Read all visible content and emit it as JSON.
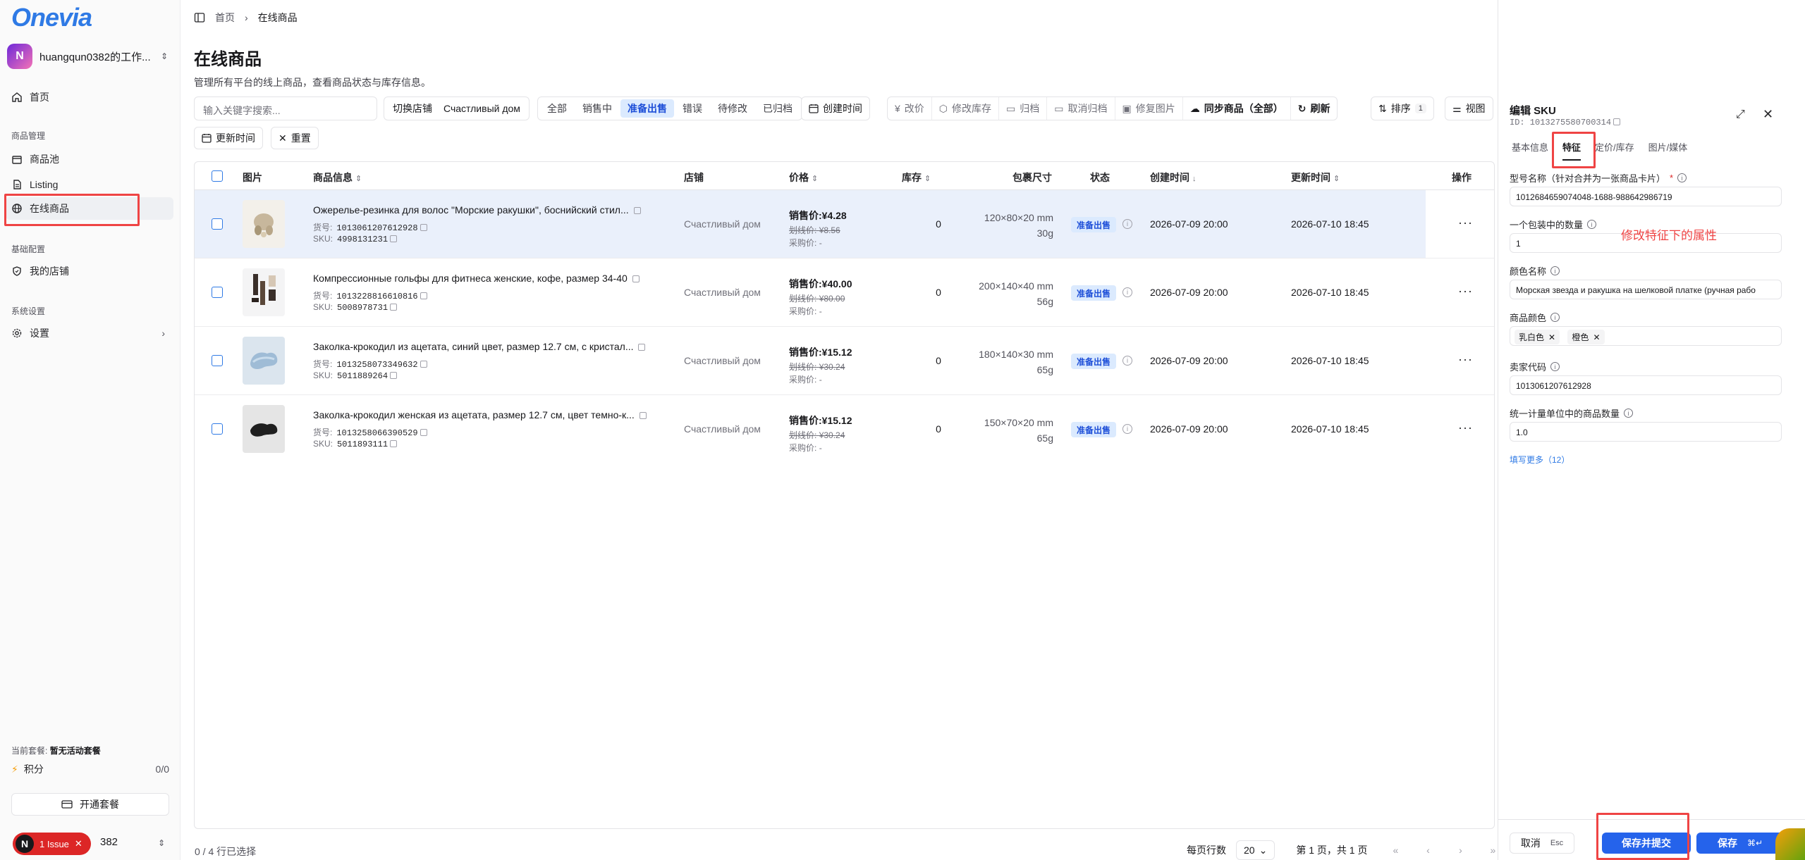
{
  "app": {
    "logo": "Onevia"
  },
  "workspace": {
    "avatar": "N",
    "name": "huangqun0382的工作..."
  },
  "sidebar": {
    "home": "首页",
    "group_product": "商品管理",
    "product_pool": "商品池",
    "listing": "Listing",
    "online": "在线商品",
    "group_base": "基础配置",
    "my_shop": "我的店铺",
    "group_system": "系统设置",
    "settings": "设置"
  },
  "plan": {
    "label": "当前套餐:",
    "value": "暂无活动套餐"
  },
  "points": {
    "label": "积分",
    "value": "0/0"
  },
  "open_plan": "开通套餐",
  "issue": {
    "avatar": "N",
    "text": "1 Issue"
  },
  "user_tail": "382",
  "breadcrumb": {
    "home": "首页",
    "current": "在线商品"
  },
  "page": {
    "title": "在线商品",
    "subtitle": "管理所有平台的线上商品，查看商品状态与库存信息。"
  },
  "search": {
    "placeholder": "输入关键字搜索..."
  },
  "shop_filter": {
    "label": "切换店铺",
    "value": "Счастливый дом"
  },
  "status_tabs": [
    "全部",
    "销售中",
    "准备出售",
    "错误",
    "待修改",
    "已归档"
  ],
  "filters": {
    "created": "创建时间",
    "updated": "更新时间",
    "reset": "重置"
  },
  "actions": {
    "price": "改价",
    "stock": "修改库存",
    "archive": "归档",
    "unarchive": "取消归档",
    "fix_image": "修复图片",
    "sync": "同步商品（全部）",
    "refresh": "刷新",
    "sort": "排序",
    "sort_count": "1",
    "view": "视图"
  },
  "columns": {
    "image": "图片",
    "info": "商品信息",
    "shop": "店铺",
    "price": "价格",
    "stock": "库存",
    "size": "包裹尺寸",
    "status": "状态",
    "created": "创建时间",
    "updated": "更新时间",
    "ops": "操作"
  },
  "labels": {
    "sku_no": "货号:",
    "sku": "SKU:",
    "sale_price": "销售价:",
    "strike_price": "划线价:",
    "cost_price": "采购价:",
    "dash": "-"
  },
  "rows": [
    {
      "name": "Ожерелье-резинка для волос \"Морские ракушки\", боснийский стил...",
      "code": "1013061207612928",
      "sku": "4998131231",
      "shop": "Счастливый дом",
      "sale": "¥4.28",
      "strike": "¥8.56",
      "stock": "0",
      "dims": "120×80×20 mm",
      "weight": "30g",
      "status": "准备出售",
      "created": "2026-07-09 20:00",
      "updated": "2026-07-10 18:45"
    },
    {
      "name": "Компрессионные гольфы для фитнеса женские, кофе, размер 34-40",
      "code": "1013228816610816",
      "sku": "5008978731",
      "shop": "Счастливый дом",
      "sale": "¥40.00",
      "strike": "¥80.00",
      "stock": "0",
      "dims": "200×140×40 mm",
      "weight": "56g",
      "status": "准备出售",
      "created": "2026-07-09 20:00",
      "updated": "2026-07-10 18:45"
    },
    {
      "name": "Заколка-крокодил из ацетата, синий цвет, размер 12.7 см, с кристал...",
      "code": "1013258073349632",
      "sku": "5011889264",
      "shop": "Счастливый дом",
      "sale": "¥15.12",
      "strike": "¥30.24",
      "stock": "0",
      "dims": "180×140×30 mm",
      "weight": "65g",
      "status": "准备出售",
      "created": "2026-07-09 20:00",
      "updated": "2026-07-10 18:45"
    },
    {
      "name": "Заколка-крокодил женская из ацетата, размер 12.7 см, цвет темно-к...",
      "code": "1013258066390529",
      "sku": "5011893111",
      "shop": "Счастливый дом",
      "sale": "¥15.12",
      "strike": "¥30.24",
      "stock": "0",
      "dims": "150×70×20 mm",
      "weight": "65g",
      "status": "准备出售",
      "created": "2026-07-09 20:00",
      "updated": "2026-07-10 18:45"
    }
  ],
  "footer": {
    "selection": "0 / 4 行已选择",
    "rows_per_page_label": "每页行数",
    "rows_per_page": "20",
    "page_info": "第 1 页，共 1 页"
  },
  "panel": {
    "title": "编辑 SKU",
    "id": "ID: 1013275580700314",
    "tabs": [
      "基本信息",
      "特征",
      "定价/库存",
      "图片/媒体"
    ],
    "fields": {
      "model_label": "型号名称（针对合并为一张商品卡片）",
      "model_value": "1012684659074048-1688-988642986719",
      "pack_label": "一个包装中的数量",
      "pack_value": "1",
      "color_name_label": "颜色名称",
      "color_name_value": "Морская звезда и ракушка на шелковой платке (ручная рабо",
      "color_label": "商品颜色",
      "color_chips": [
        "乳白色",
        "橙色"
      ],
      "seller_code_label": "卖家代码",
      "seller_code_value": "1013061207612928",
      "unit_label": "统一计量单位中的商品数量",
      "unit_value": "1.0"
    },
    "fill_more": "填写更多（12）",
    "annotation": "修改特征下的属性",
    "cancel": "取消",
    "esc": "Esc",
    "submit": "保存并提交",
    "save": "保存",
    "save_key": "⌘↵"
  },
  "colors": {
    "accent": "#2563eb",
    "badge_bg": "#dbeafe",
    "annotation": "#ef4444"
  }
}
